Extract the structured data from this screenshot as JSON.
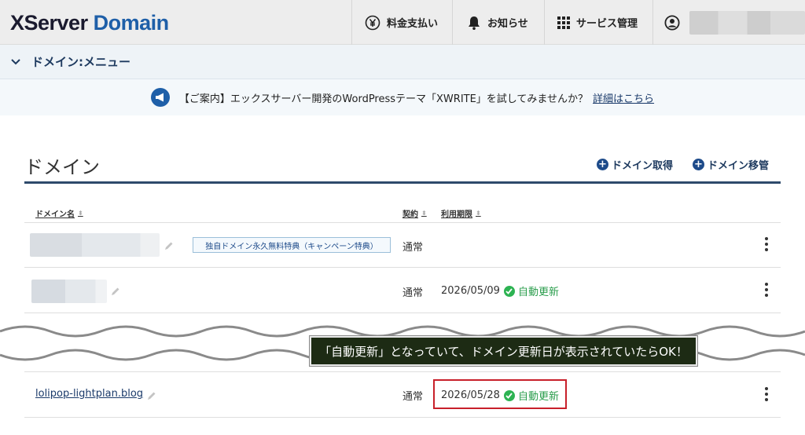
{
  "header": {
    "logo_x": "XServer",
    "logo_domain": "Domain",
    "nav": {
      "fees": "料金支払い",
      "news": "お知らせ",
      "services": "サービス管理"
    }
  },
  "menubar": {
    "label": "ドメイン:メニュー"
  },
  "notice": {
    "text": "【ご案内】エックスサーバー開発のWordPressテーマ「XWRITE」を試してみませんか？",
    "link": "詳細はこちら"
  },
  "section": {
    "title": "ドメイン",
    "acquire": "ドメイン取得",
    "transfer": "ドメイン移管"
  },
  "table": {
    "headers": {
      "name": "ドメイン名",
      "contract": "契約",
      "expiry": "利用期限"
    },
    "rows": [
      {
        "badge": "独自ドメイン永久無料特典（キャンペーン特典）",
        "contract": "通常",
        "expiry": "",
        "auto": ""
      },
      {
        "contract": "通常",
        "expiry": "2026/05/09",
        "auto": "自動更新"
      },
      {
        "domain": "lolipop-lightplan.blog",
        "contract": "通常",
        "expiry": "2026/05/28",
        "auto": "自動更新"
      }
    ]
  },
  "tooltip": "「自動更新」となっていて、ドメイン更新日が表示されていたらOK！",
  "colors": {
    "brand": "#1e5fa8",
    "navy": "#2e4a6b",
    "success": "#2db352",
    "highlight": "#c8202a"
  }
}
